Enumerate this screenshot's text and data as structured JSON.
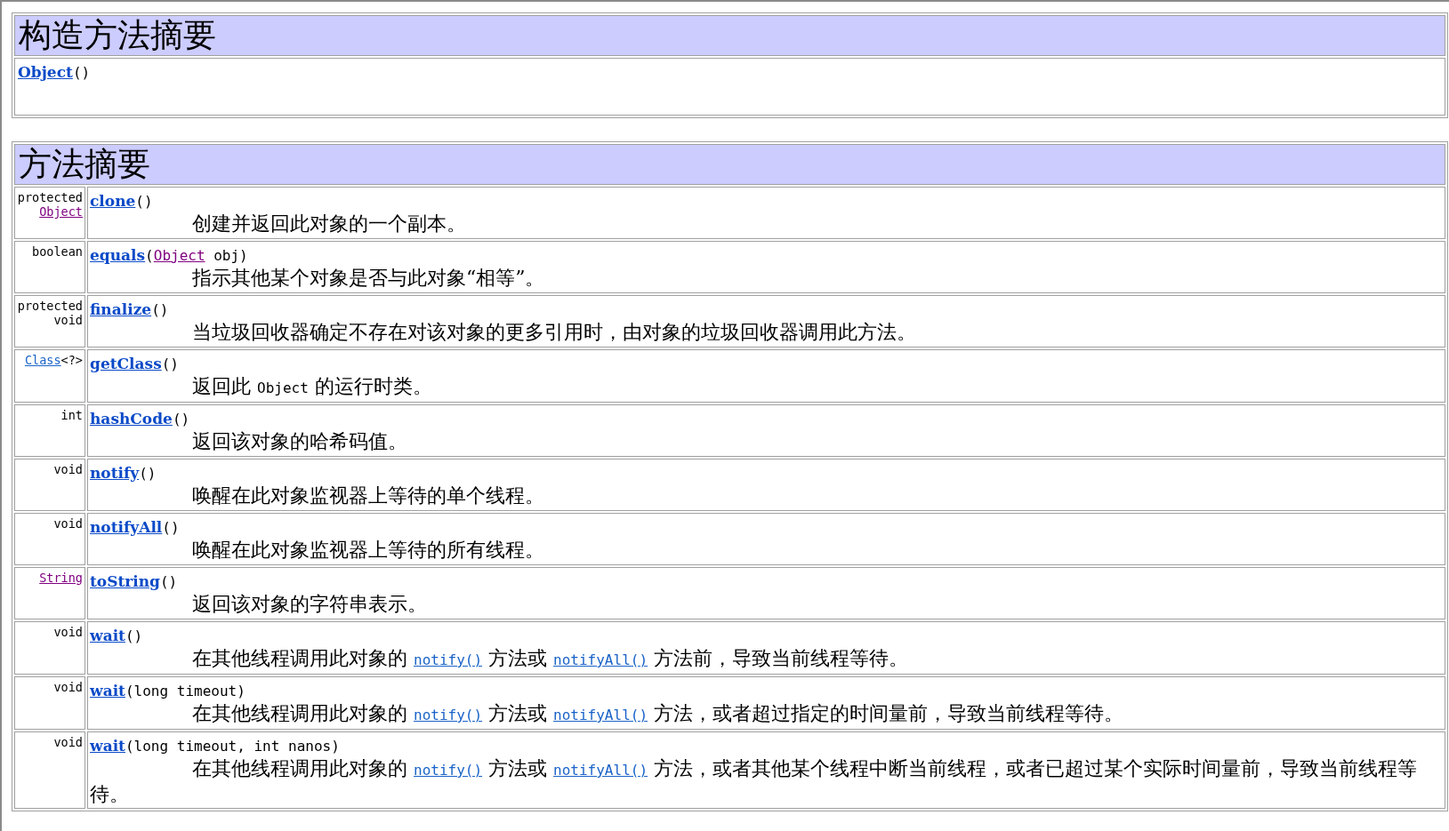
{
  "constructor_summary": {
    "title": "构造方法摘要",
    "constructors": [
      {
        "name": "Object",
        "params": [
          {
            "kind": "text",
            "text": "()"
          }
        ]
      }
    ]
  },
  "method_summary": {
    "title": "方法摘要",
    "methods": [
      {
        "modifier": [
          {
            "kind": "text",
            "text": "protected"
          },
          {
            "kind": "link",
            "text": "Object",
            "visited": true
          }
        ],
        "name": "clone",
        "params": [
          {
            "kind": "text",
            "text": "()"
          }
        ],
        "description": [
          {
            "kind": "text",
            "text": "创建并返回此对象的一个副本。"
          }
        ]
      },
      {
        "modifier": [
          {
            "kind": "text",
            "text": "boolean"
          }
        ],
        "name": "equals",
        "params": [
          {
            "kind": "text",
            "text": "("
          },
          {
            "kind": "link",
            "text": "Object",
            "visited": true
          },
          {
            "kind": "text",
            "text": " obj)"
          }
        ],
        "description": [
          {
            "kind": "text",
            "text": "指示其他某个对象是否与此对象“相等”。"
          }
        ]
      },
      {
        "modifier": [
          {
            "kind": "text",
            "text": "protected"
          },
          {
            "kind": "text",
            "text": "void"
          }
        ],
        "name": "finalize",
        "params": [
          {
            "kind": "text",
            "text": "()"
          }
        ],
        "description": [
          {
            "kind": "text",
            "text": "当垃圾回收器确定不存在对该对象的更多引用时，由对象的垃圾回收器调用此方法。"
          }
        ]
      },
      {
        "modifier": [
          {
            "kind": "link",
            "text": "Class",
            "visited": false
          },
          {
            "kind": "inline",
            "text": "<?>"
          }
        ],
        "name": "getClass",
        "params": [
          {
            "kind": "text",
            "text": "()"
          }
        ],
        "description": [
          {
            "kind": "text",
            "text": "返回此 "
          },
          {
            "kind": "code",
            "text": "Object"
          },
          {
            "kind": "text",
            "text": " 的运行时类。"
          }
        ]
      },
      {
        "modifier": [
          {
            "kind": "text",
            "text": "int"
          }
        ],
        "name": "hashCode",
        "params": [
          {
            "kind": "text",
            "text": "()"
          }
        ],
        "description": [
          {
            "kind": "text",
            "text": "返回该对象的哈希码值。"
          }
        ]
      },
      {
        "modifier": [
          {
            "kind": "text",
            "text": "void"
          }
        ],
        "name": "notify",
        "params": [
          {
            "kind": "text",
            "text": "()"
          }
        ],
        "description": [
          {
            "kind": "text",
            "text": "唤醒在此对象监视器上等待的单个线程。"
          }
        ]
      },
      {
        "modifier": [
          {
            "kind": "text",
            "text": "void"
          }
        ],
        "name": "notifyAll",
        "params": [
          {
            "kind": "text",
            "text": "()"
          }
        ],
        "description": [
          {
            "kind": "text",
            "text": "唤醒在此对象监视器上等待的所有线程。"
          }
        ]
      },
      {
        "modifier": [
          {
            "kind": "link",
            "text": "String",
            "visited": true
          }
        ],
        "name": "toString",
        "params": [
          {
            "kind": "text",
            "text": "()"
          }
        ],
        "description": [
          {
            "kind": "text",
            "text": "返回该对象的字符串表示。"
          }
        ]
      },
      {
        "modifier": [
          {
            "kind": "text",
            "text": "void"
          }
        ],
        "name": "wait",
        "params": [
          {
            "kind": "text",
            "text": "()"
          }
        ],
        "description": [
          {
            "kind": "text",
            "text": "在其他线程调用此对象的 "
          },
          {
            "kind": "link",
            "text": "notify()",
            "visited": false
          },
          {
            "kind": "text",
            "text": " 方法或 "
          },
          {
            "kind": "link",
            "text": "notifyAll()",
            "visited": false
          },
          {
            "kind": "text",
            "text": " 方法前，导致当前线程等待。"
          }
        ]
      },
      {
        "modifier": [
          {
            "kind": "text",
            "text": "void"
          }
        ],
        "name": "wait",
        "params": [
          {
            "kind": "text",
            "text": "(long timeout)"
          }
        ],
        "description": [
          {
            "kind": "text",
            "text": "在其他线程调用此对象的 "
          },
          {
            "kind": "link",
            "text": "notify()",
            "visited": false
          },
          {
            "kind": "text",
            "text": " 方法或 "
          },
          {
            "kind": "link",
            "text": "notifyAll()",
            "visited": false
          },
          {
            "kind": "text",
            "text": " 方法，或者超过指定的时间量前，导致当前线程等待。"
          }
        ]
      },
      {
        "modifier": [
          {
            "kind": "text",
            "text": "void"
          }
        ],
        "name": "wait",
        "params": [
          {
            "kind": "text",
            "text": "(long timeout, int nanos)"
          }
        ],
        "description": [
          {
            "kind": "text",
            "text": "在其他线程调用此对象的 "
          },
          {
            "kind": "link",
            "text": "notify()",
            "visited": false
          },
          {
            "kind": "text",
            "text": " 方法或 "
          },
          {
            "kind": "link",
            "text": "notifyAll()",
            "visited": false
          },
          {
            "kind": "text",
            "text": " 方法，或者其他某个线程中断当前线程，或者已超过某个实际时间量前，导致当前线程等待。"
          }
        ]
      }
    ]
  }
}
